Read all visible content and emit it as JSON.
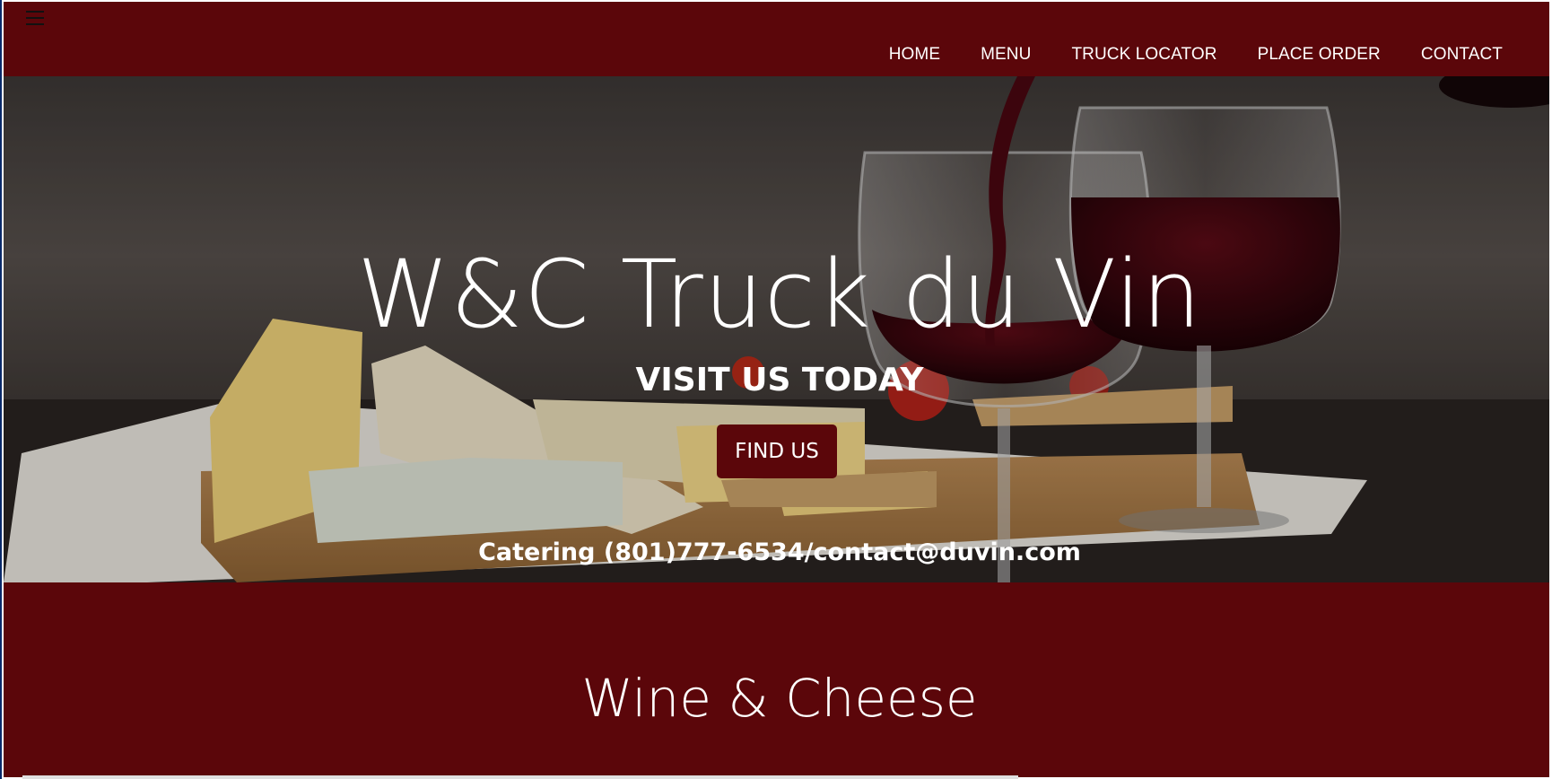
{
  "nav": {
    "menu_icon": "hamburger-icon",
    "items": [
      "HOME",
      "MENU",
      "TRUCK LOCATOR",
      "PLACE ORDER",
      "CONTACT"
    ]
  },
  "hero": {
    "title": "W&C Truck du Vin",
    "subtitle": "VISIT US TODAY",
    "button_label": "FIND US",
    "catering": "Catering (801)777-6534/contact@duvin.com"
  },
  "section": {
    "title": "Wine & Cheese"
  },
  "colors": {
    "brand": "#5b060a",
    "text": "#ffffff"
  }
}
